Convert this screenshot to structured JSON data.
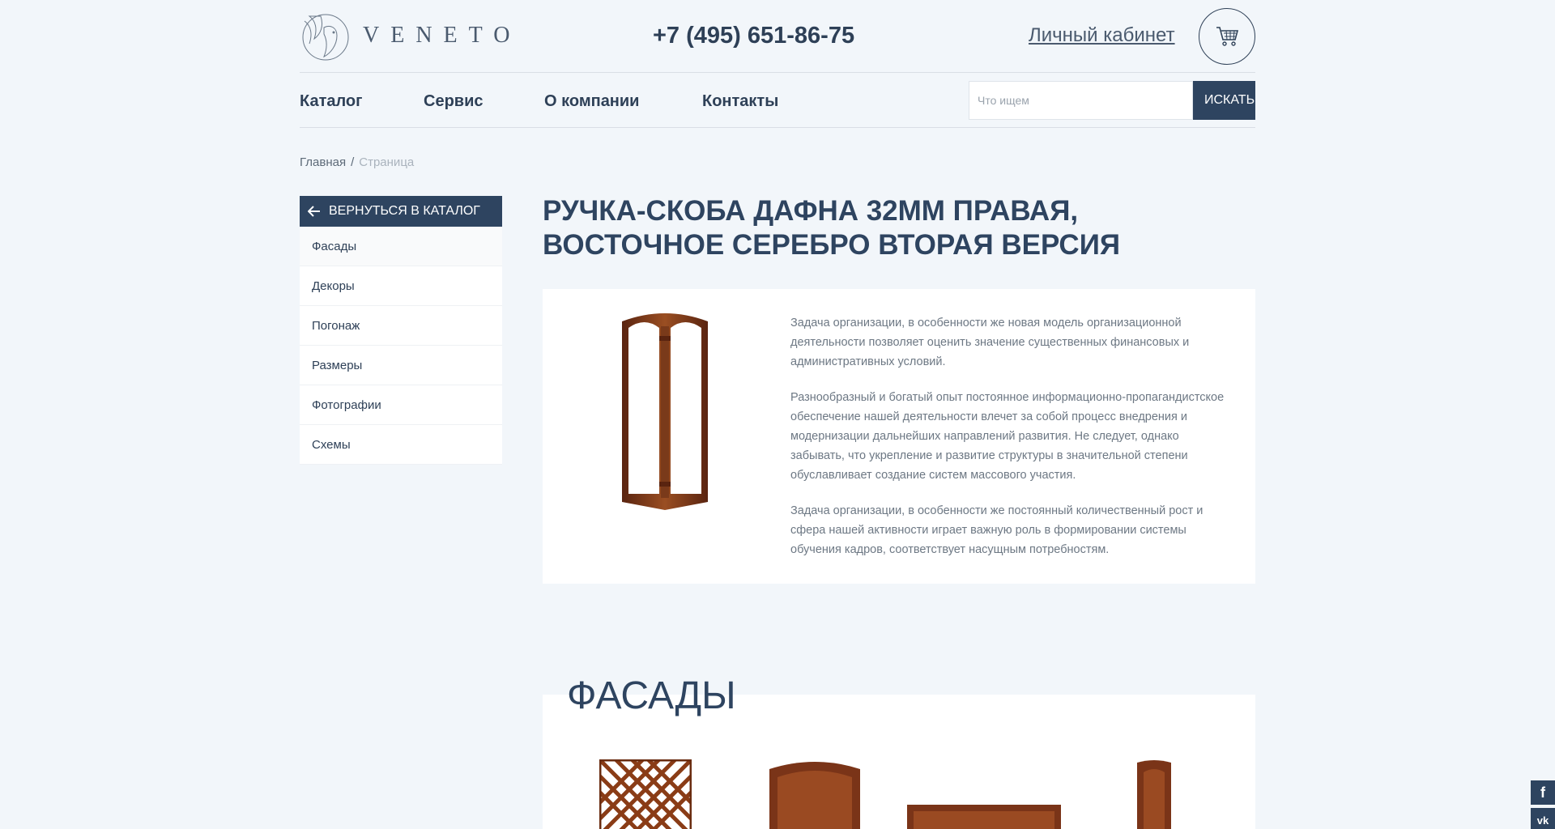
{
  "header": {
    "logo_text": "VENETO",
    "phone": "+7 (495) 651-86-75",
    "cabinet_label": "Личный кабинет",
    "cart_icon": "cart-icon"
  },
  "nav": {
    "items": [
      {
        "label": "Каталог"
      },
      {
        "label": "Сервис"
      },
      {
        "label": "О компании"
      },
      {
        "label": "Контакты"
      }
    ],
    "search_placeholder": "Что ищем",
    "search_button": "ИСКАТЬ"
  },
  "breadcrumb": {
    "home": "Главная",
    "separator": "/",
    "current": "Страница"
  },
  "sidebar": {
    "back_label": "ВЕРНУТЬСЯ В КАТАЛОГ",
    "items": [
      {
        "label": "Фасады"
      },
      {
        "label": "Декоры"
      },
      {
        "label": "Погонаж"
      },
      {
        "label": "Размеры"
      },
      {
        "label": "Фотографии"
      },
      {
        "label": "Схемы"
      }
    ]
  },
  "product": {
    "title": "Ручка-скоба Дафна 32мм правая, восточное серебро вторая версия",
    "paragraphs": [
      "Задача организации, в особенности же новая модель организационной деятельности позволяет оценить значение существенных финансовых и административных условий.",
      "Разнообразный и богатый опыт постоянное информационно-пропагандистское обеспечение нашей деятельности влечет за собой процесс внедрения и модернизации дальнейших направлений развития. Не следует, однако забывать, что укрепление и развитие структуры в значительной степени обуславливает создание систем массового участия.",
      "Задача организации, в особенности же постоянный количественный рост и сфера нашей активности играет важную роль в формировании системы обучения кадров, соответствует насущным потребностям."
    ]
  },
  "facades": {
    "title": "ФАСАДЫ"
  },
  "social": [
    {
      "icon": "facebook-icon",
      "glyph": "f"
    },
    {
      "icon": "vk-icon",
      "glyph": "vk"
    }
  ],
  "colors": {
    "background": "#f2f6fa",
    "primary": "#2e4460",
    "wood": "#7a3a1a"
  }
}
